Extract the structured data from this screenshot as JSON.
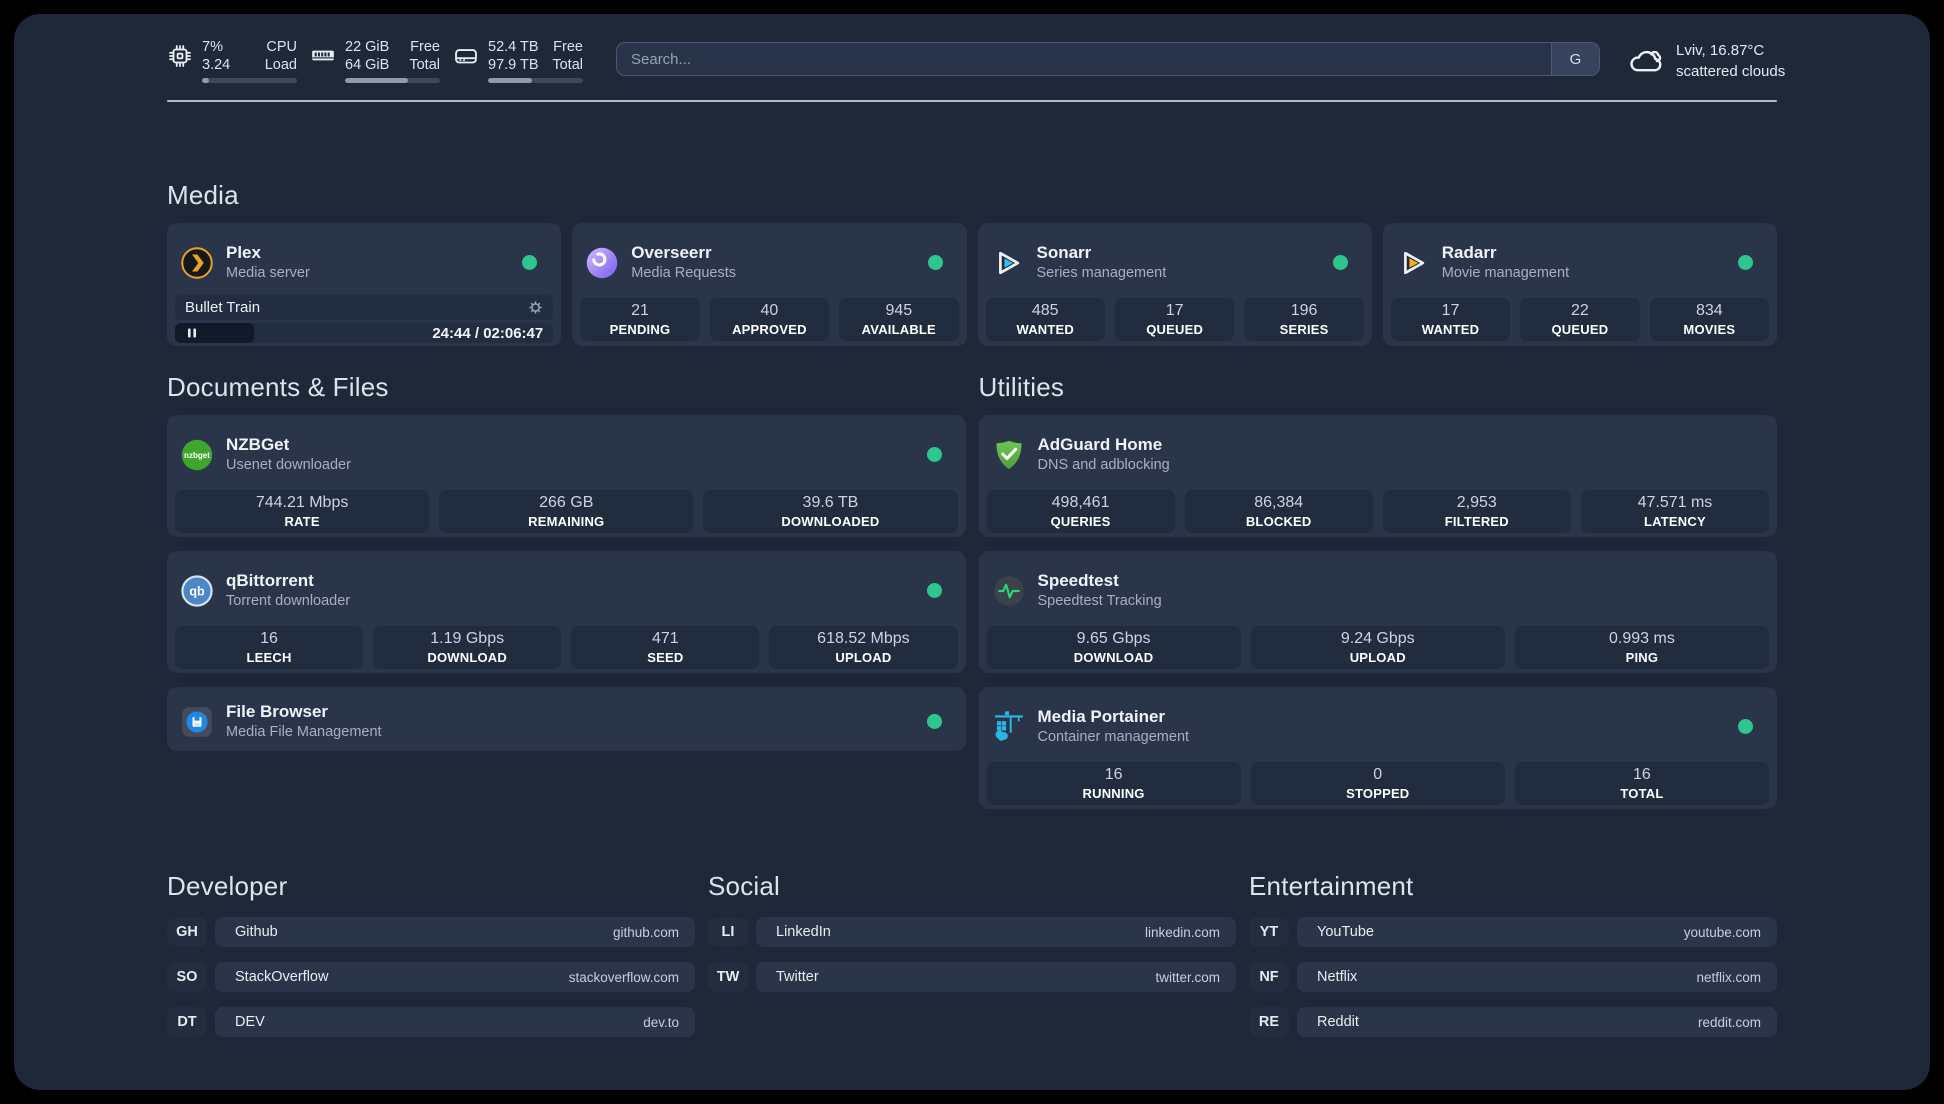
{
  "topbar": {
    "cpu": {
      "v1": "7%",
      "v2": "3.24",
      "l1": "CPU",
      "l2": "Load",
      "pct": 7
    },
    "mem": {
      "v1": "22 GiB",
      "v2": "64 GiB",
      "l1": "Free",
      "l2": "Total",
      "pct": 66
    },
    "disk": {
      "v1": "52.4 TB",
      "v2": "97.9 TB",
      "l1": "Free",
      "l2": "Total",
      "pct": 46
    },
    "search": {
      "placeholder": "Search...",
      "button": "G"
    },
    "weather": {
      "location": "Lviv, 16.87°C",
      "condition": "scattered clouds"
    }
  },
  "media": {
    "title": "Media",
    "plex": {
      "name": "Plex",
      "desc": "Media server",
      "now_playing": "Bullet Train",
      "time": "24:44 / 02:06:47",
      "progress_pct": 21
    },
    "overseerr": {
      "name": "Overseerr",
      "desc": "Media Requests",
      "stats": [
        {
          "value": "21",
          "label": "PENDING"
        },
        {
          "value": "40",
          "label": "APPROVED"
        },
        {
          "value": "945",
          "label": "AVAILABLE"
        }
      ]
    },
    "sonarr": {
      "name": "Sonarr",
      "desc": "Series management",
      "stats": [
        {
          "value": "485",
          "label": "WANTED"
        },
        {
          "value": "17",
          "label": "QUEUED"
        },
        {
          "value": "196",
          "label": "SERIES"
        }
      ]
    },
    "radarr": {
      "name": "Radarr",
      "desc": "Movie management",
      "stats": [
        {
          "value": "17",
          "label": "WANTED"
        },
        {
          "value": "22",
          "label": "QUEUED"
        },
        {
          "value": "834",
          "label": "MOVIES"
        }
      ]
    }
  },
  "documents": {
    "title": "Documents & Files",
    "nzbget": {
      "name": "NZBGet",
      "desc": "Usenet downloader",
      "stats": [
        {
          "value": "744.21 Mbps",
          "label": "RATE"
        },
        {
          "value": "266 GB",
          "label": "REMAINING"
        },
        {
          "value": "39.6 TB",
          "label": "DOWNLOADED"
        }
      ]
    },
    "qbittorrent": {
      "name": "qBittorrent",
      "desc": "Torrent downloader",
      "stats": [
        {
          "value": "16",
          "label": "LEECH"
        },
        {
          "value": "1.19 Gbps",
          "label": "DOWNLOAD"
        },
        {
          "value": "471",
          "label": "SEED"
        },
        {
          "value": "618.52 Mbps",
          "label": "UPLOAD"
        }
      ]
    },
    "filebrowser": {
      "name": "File Browser",
      "desc": "Media File Management"
    }
  },
  "utilities": {
    "title": "Utilities",
    "adguard": {
      "name": "AdGuard Home",
      "desc": "DNS and adblocking",
      "stats": [
        {
          "value": "498,461",
          "label": "QUERIES"
        },
        {
          "value": "86,384",
          "label": "BLOCKED"
        },
        {
          "value": "2,953",
          "label": "FILTERED"
        },
        {
          "value": "47.571 ms",
          "label": "LATENCY"
        }
      ]
    },
    "speedtest": {
      "name": "Speedtest",
      "desc": "Speedtest Tracking",
      "stats": [
        {
          "value": "9.65 Gbps",
          "label": "DOWNLOAD"
        },
        {
          "value": "9.24 Gbps",
          "label": "UPLOAD"
        },
        {
          "value": "0.993 ms",
          "label": "PING"
        }
      ]
    },
    "portainer": {
      "name": "Media Portainer",
      "desc": "Container management",
      "stats": [
        {
          "value": "16",
          "label": "RUNNING"
        },
        {
          "value": "0",
          "label": "STOPPED"
        },
        {
          "value": "16",
          "label": "TOTAL"
        }
      ]
    }
  },
  "bookmarks": {
    "developer": {
      "title": "Developer",
      "items": [
        {
          "abbr": "GH",
          "name": "Github",
          "url": "github.com"
        },
        {
          "abbr": "SO",
          "name": "StackOverflow",
          "url": "stackoverflow.com"
        },
        {
          "abbr": "DT",
          "name": "DEV",
          "url": "dev.to"
        }
      ]
    },
    "social": {
      "title": "Social",
      "items": [
        {
          "abbr": "LI",
          "name": "LinkedIn",
          "url": "linkedin.com"
        },
        {
          "abbr": "TW",
          "name": "Twitter",
          "url": "twitter.com"
        }
      ]
    },
    "entertainment": {
      "title": "Entertainment",
      "items": [
        {
          "abbr": "YT",
          "name": "YouTube",
          "url": "youtube.com"
        },
        {
          "abbr": "NF",
          "name": "Netflix",
          "url": "netflix.com"
        },
        {
          "abbr": "RE",
          "name": "Reddit",
          "url": "reddit.com"
        }
      ]
    }
  }
}
